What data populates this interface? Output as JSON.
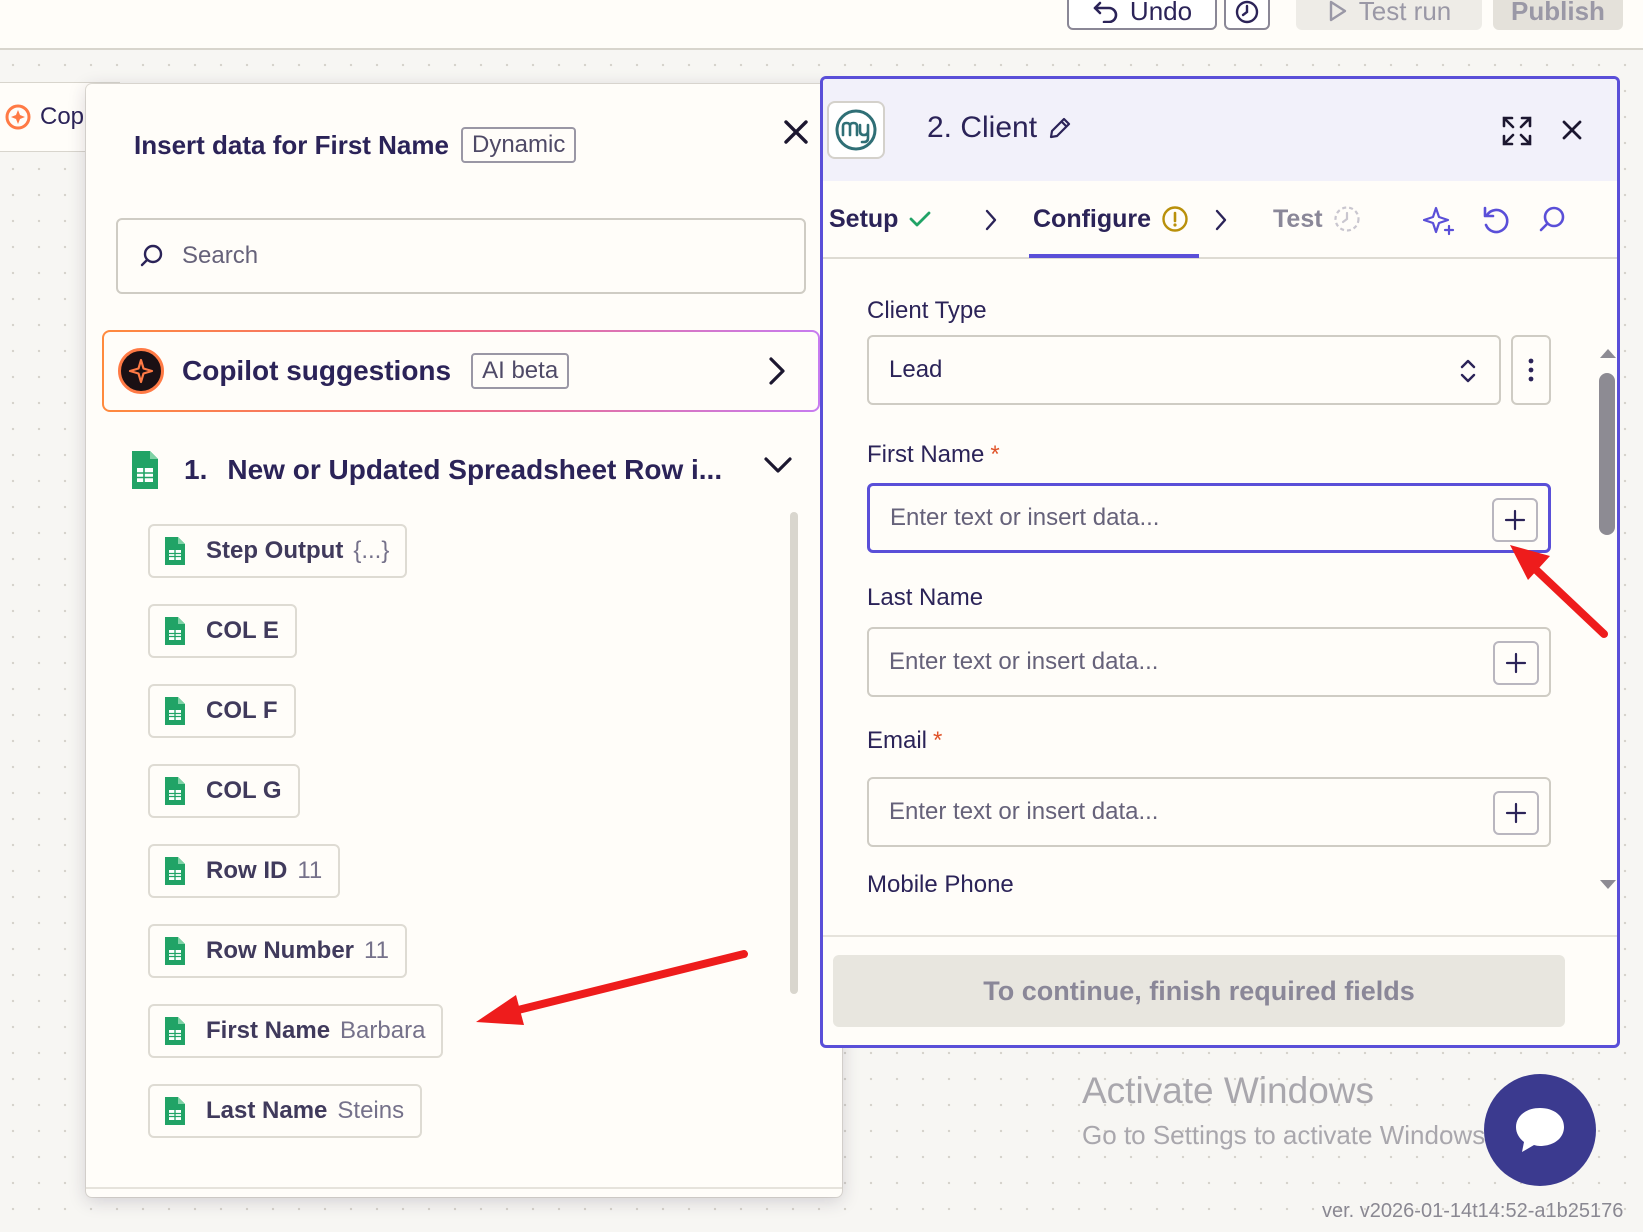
{
  "toolbar": {
    "undo_label": "Undo",
    "test_run_label": "Test run",
    "publish_label": "Publish"
  },
  "background_node": {
    "label": "Cop"
  },
  "picker": {
    "title": "Insert data for First Name",
    "title_badge": "Dynamic",
    "search_placeholder": "Search",
    "copilot": {
      "label": "Copilot suggestions",
      "badge": "AI beta"
    },
    "step": {
      "number": "1.",
      "title": "New or Updated Spreadsheet Row i..."
    },
    "fields": [
      {
        "key": "Step Output",
        "value": "{...}"
      },
      {
        "key": "COL E",
        "value": ""
      },
      {
        "key": "COL F",
        "value": ""
      },
      {
        "key": "COL G",
        "value": ""
      },
      {
        "key": "Row ID",
        "value": "11"
      },
      {
        "key": "Row Number",
        "value": "11"
      },
      {
        "key": "First Name",
        "value": "Barbara"
      },
      {
        "key": "Last Name",
        "value": "Steins"
      }
    ]
  },
  "panel": {
    "title": "2. Client",
    "tabs": [
      {
        "label": "Setup",
        "status": "complete"
      },
      {
        "label": "Configure",
        "status": "warning"
      },
      {
        "label": "Test",
        "status": "pending"
      }
    ],
    "client_type": {
      "label": "Client Type",
      "value": "Lead"
    },
    "first_name": {
      "label": "First Name",
      "required": "*",
      "placeholder": "Enter text or insert data..."
    },
    "last_name": {
      "label": "Last Name",
      "placeholder": "Enter text or insert data..."
    },
    "email": {
      "label": "Email",
      "required": "*",
      "placeholder": "Enter text or insert data..."
    },
    "mobile_phone": {
      "label": "Mobile Phone"
    },
    "continue_label": "To continue, finish required fields"
  },
  "watermark": {
    "line1": "Activate Windows",
    "line2": "Go to Settings to activate Windows."
  },
  "version": "ver. v2026-01-14t14:52-a1b25176",
  "colors": {
    "accent": "#5a4fd8",
    "sheets_green": "#21a366",
    "annotation_red": "#ee1c1c",
    "required": "#e0542a"
  }
}
